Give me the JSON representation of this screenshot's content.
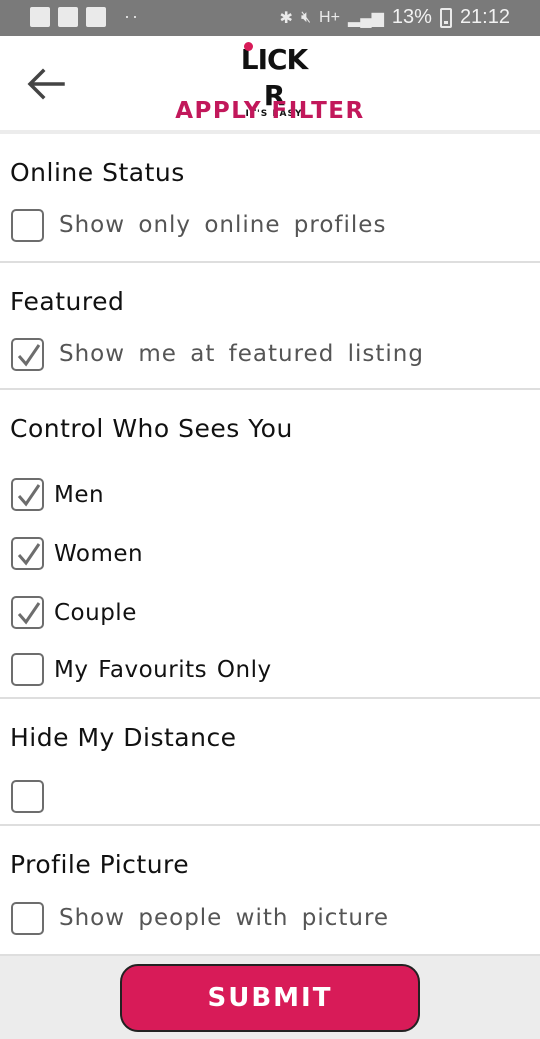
{
  "status_bar": {
    "network": "H+",
    "battery": "13%",
    "time": "21:12",
    "dots": "··",
    "icons": [
      "gmail-icon",
      "facebook-icon",
      "gallery-icon",
      "bluetooth-icon",
      "mute-icon",
      "signal-icon",
      "battery-icon"
    ]
  },
  "header": {
    "logo_main": "LICK R",
    "logo_tagline": "IT'S EASY",
    "title": "APPLY FILTER",
    "back_icon": "arrow-left-icon"
  },
  "sections": {
    "online_status": {
      "title": "Online Status",
      "option": {
        "label": "Show only online profiles",
        "checked": false
      }
    },
    "featured": {
      "title": "Featured",
      "option": {
        "label": "Show me at featured listing",
        "checked": true
      }
    },
    "control": {
      "title": "Control Who Sees You",
      "options": [
        {
          "label": "Men",
          "checked": true
        },
        {
          "label": "Women",
          "checked": true
        },
        {
          "label": "Couple",
          "checked": true
        },
        {
          "label": "My Favourits Only",
          "checked": false
        }
      ]
    },
    "distance": {
      "title": "Hide My Distance",
      "option": {
        "label": "",
        "checked": false
      }
    },
    "picture": {
      "title": "Profile Picture",
      "option": {
        "label": "Show people with picture",
        "checked": false
      }
    }
  },
  "submit_label": "SUBMIT",
  "colors": {
    "accent": "#d81b58",
    "title_pink": "#c2185b",
    "status_bar": "#7a7a7a",
    "divider": "#dedede"
  }
}
